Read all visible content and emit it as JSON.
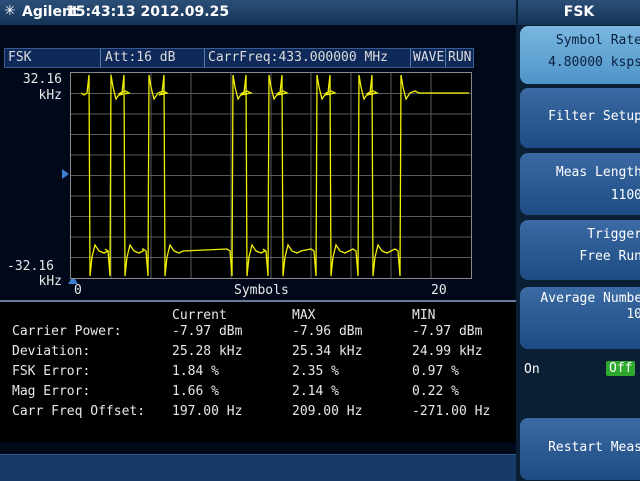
{
  "header": {
    "brand": "Agilent",
    "time": "15:43:13 2012.09.25",
    "mode": "FSK"
  },
  "status": {
    "mode": "FSK",
    "attenuation": "Att:16 dB",
    "carrier_freq": "CarrFreq:433.000000 MHz",
    "wave": "WAVE",
    "run": "RUN"
  },
  "plot": {
    "y_top": "32.16",
    "y_top_unit": "kHz",
    "y_bottom": "-32.16",
    "y_bottom_unit": "kHz",
    "x_start": "0",
    "x_label": "Symbols",
    "x_end": "20",
    "trace_color": "#f0f000",
    "grid_color": "#5a5a5a",
    "levels": [
      1,
      1,
      -1,
      1,
      -1,
      1,
      -1,
      -1,
      -1,
      -1,
      -1,
      1,
      -1,
      1,
      1,
      -1,
      1,
      -1,
      -1,
      1,
      1
    ],
    "transitions": [
      0.95,
      2.0,
      2.7,
      3.9,
      4.7,
      8.1,
      8.8,
      9.9,
      10.6,
      12.3,
      13.0,
      14.4,
      15.1,
      16.5
    ]
  },
  "results": {
    "headers": [
      "Current",
      "MAX",
      "MIN"
    ],
    "rows": [
      {
        "label": "Carrier Power:",
        "current": "-7.97 dBm",
        "max": "-7.96 dBm",
        "min": "-7.97 dBm"
      },
      {
        "label": "Deviation:",
        "current": "25.28 kHz",
        "max": "25.34 kHz",
        "min": "24.99 kHz"
      },
      {
        "label": "FSK Error:",
        "current": "1.84 %",
        "max": "2.35 %",
        "min": "0.97 %"
      },
      {
        "label": "Mag Error:",
        "current": "1.66 %",
        "max": "2.14 %",
        "min": "0.22 %"
      },
      {
        "label": "Carr Freq Offset:",
        "current": "197.00 Hz",
        "max": "209.00 Hz",
        "min": "-271.00 Hz"
      }
    ]
  },
  "softkeys": {
    "title": "FSK",
    "symbol_rate_label": "Symbol Rate",
    "symbol_rate_value": "4.80000 ksps",
    "filter_setup_label": "Filter Setup",
    "meas_length_label": "Meas Length",
    "meas_length_value": "1100",
    "trigger_label": "Trigger",
    "trigger_value": "Free Run",
    "avg_label": "Average Number",
    "avg_value": "10",
    "avg_on": "On",
    "avg_off": "Off",
    "restart_label": "Restart Meas"
  }
}
